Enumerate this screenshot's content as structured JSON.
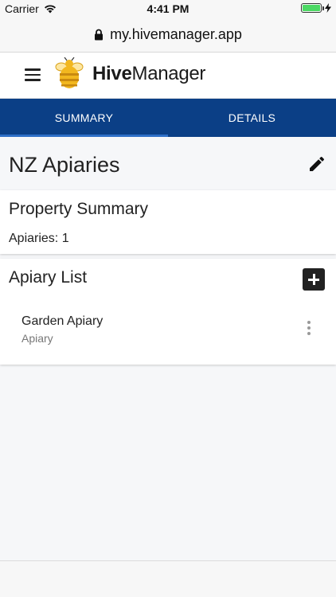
{
  "status_bar": {
    "carrier": "Carrier",
    "time": "4:41 PM",
    "battery_level": 1.0,
    "battery_color": "#4cd964"
  },
  "browser": {
    "url": "my.hivemanager.app",
    "lock_icon": "lock-icon"
  },
  "header": {
    "menu_icon": "hamburger-menu-icon",
    "logo_bold": "Hive",
    "logo_regular": "Manager"
  },
  "tabs": [
    {
      "label": "SUMMARY",
      "active": true
    },
    {
      "label": "DETAILS",
      "active": false
    }
  ],
  "page": {
    "title": "NZ Apiaries",
    "edit_icon": "pencil-icon"
  },
  "property_summary": {
    "title": "Property Summary",
    "apiaries_line": "Apiaries: 1"
  },
  "apiary_list": {
    "title": "Apiary List",
    "add_icon": "plus-icon",
    "items": [
      {
        "name": "Garden Apiary",
        "type": "Apiary"
      }
    ]
  },
  "colors": {
    "tab_bar": "#0b3f86",
    "tab_indicator": "#2e6fc7",
    "logo_bee": "#f2b71f"
  }
}
